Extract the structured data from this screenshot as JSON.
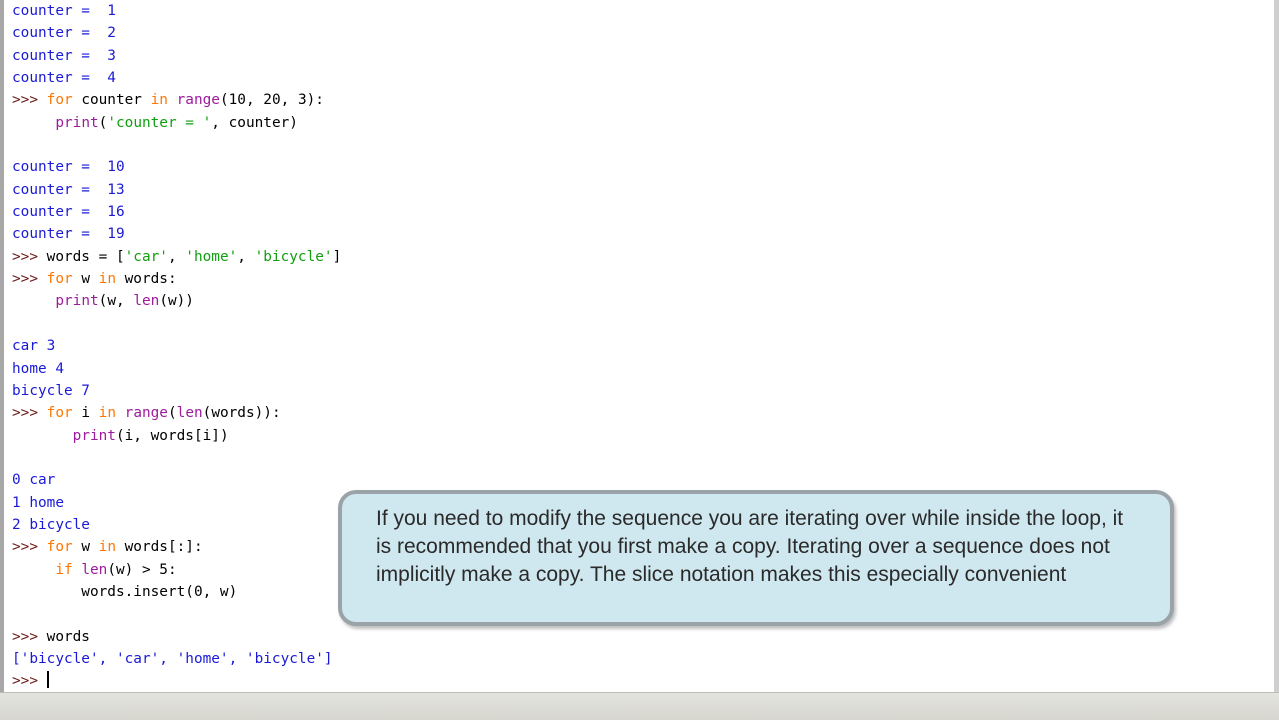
{
  "console": {
    "lines": [
      [
        {
          "t": "counter =  1",
          "c": "out"
        }
      ],
      [
        {
          "t": "counter =  2",
          "c": "out"
        }
      ],
      [
        {
          "t": "counter =  3",
          "c": "out"
        }
      ],
      [
        {
          "t": "counter =  4",
          "c": "out"
        }
      ],
      [
        {
          "t": ">>> ",
          "c": "prompt"
        },
        {
          "t": "for",
          "c": "kw"
        },
        {
          "t": " counter ",
          "c": ""
        },
        {
          "t": "in",
          "c": "kw"
        },
        {
          "t": " ",
          "c": ""
        },
        {
          "t": "range",
          "c": "bi"
        },
        {
          "t": "(10, 20, 3):",
          "c": ""
        }
      ],
      [
        {
          "t": "     ",
          "c": ""
        },
        {
          "t": "print",
          "c": "bi"
        },
        {
          "t": "(",
          "c": ""
        },
        {
          "t": "'counter = '",
          "c": "str"
        },
        {
          "t": ", counter)",
          "c": ""
        }
      ],
      [
        {
          "t": "",
          "c": ""
        }
      ],
      [
        {
          "t": "counter =  10",
          "c": "out"
        }
      ],
      [
        {
          "t": "counter =  13",
          "c": "out"
        }
      ],
      [
        {
          "t": "counter =  16",
          "c": "out"
        }
      ],
      [
        {
          "t": "counter =  19",
          "c": "out"
        }
      ],
      [
        {
          "t": ">>> ",
          "c": "prompt"
        },
        {
          "t": "words = [",
          "c": ""
        },
        {
          "t": "'car'",
          "c": "str"
        },
        {
          "t": ", ",
          "c": ""
        },
        {
          "t": "'home'",
          "c": "str"
        },
        {
          "t": ", ",
          "c": ""
        },
        {
          "t": "'bicycle'",
          "c": "str"
        },
        {
          "t": "]",
          "c": ""
        }
      ],
      [
        {
          "t": ">>> ",
          "c": "prompt"
        },
        {
          "t": "for",
          "c": "kw"
        },
        {
          "t": " w ",
          "c": ""
        },
        {
          "t": "in",
          "c": "kw"
        },
        {
          "t": " words:",
          "c": ""
        }
      ],
      [
        {
          "t": "     ",
          "c": ""
        },
        {
          "t": "print",
          "c": "bi"
        },
        {
          "t": "(w, ",
          "c": ""
        },
        {
          "t": "len",
          "c": "bi"
        },
        {
          "t": "(w))",
          "c": ""
        }
      ],
      [
        {
          "t": "",
          "c": ""
        }
      ],
      [
        {
          "t": "car 3",
          "c": "out"
        }
      ],
      [
        {
          "t": "home 4",
          "c": "out"
        }
      ],
      [
        {
          "t": "bicycle 7",
          "c": "out"
        }
      ],
      [
        {
          "t": ">>> ",
          "c": "prompt"
        },
        {
          "t": "for",
          "c": "kw"
        },
        {
          "t": " i ",
          "c": ""
        },
        {
          "t": "in",
          "c": "kw"
        },
        {
          "t": " ",
          "c": ""
        },
        {
          "t": "range",
          "c": "bi"
        },
        {
          "t": "(",
          "c": ""
        },
        {
          "t": "len",
          "c": "bi"
        },
        {
          "t": "(words)):",
          "c": ""
        }
      ],
      [
        {
          "t": "       ",
          "c": ""
        },
        {
          "t": "print",
          "c": "bi"
        },
        {
          "t": "(i, words[i])",
          "c": ""
        }
      ],
      [
        {
          "t": "",
          "c": ""
        }
      ],
      [
        {
          "t": "0 car",
          "c": "out"
        }
      ],
      [
        {
          "t": "1 home",
          "c": "out"
        }
      ],
      [
        {
          "t": "2 bicycle",
          "c": "out"
        }
      ],
      [
        {
          "t": ">>> ",
          "c": "prompt"
        },
        {
          "t": "for",
          "c": "kw"
        },
        {
          "t": " w ",
          "c": ""
        },
        {
          "t": "in",
          "c": "kw"
        },
        {
          "t": " words[:]:",
          "c": ""
        }
      ],
      [
        {
          "t": "     ",
          "c": ""
        },
        {
          "t": "if",
          "c": "kw"
        },
        {
          "t": " ",
          "c": ""
        },
        {
          "t": "len",
          "c": "bi"
        },
        {
          "t": "(w) > 5:",
          "c": ""
        }
      ],
      [
        {
          "t": "        words.insert(0, w)",
          "c": ""
        }
      ],
      [
        {
          "t": "",
          "c": ""
        }
      ],
      [
        {
          "t": ">>> ",
          "c": "prompt"
        },
        {
          "t": "words",
          "c": ""
        }
      ],
      [
        {
          "t": "['bicycle', 'car', 'home', 'bicycle']",
          "c": "out"
        }
      ]
    ],
    "prompt": ">>> "
  },
  "callout": {
    "text": "If you need to modify the sequence you are iterating over while inside the loop, it is recommended that you first make a copy. Iterating over a sequence does not implicitly make a copy. The slice notation makes this especially convenient"
  },
  "colors": {
    "output": "#1a1ad6",
    "keyword": "#ff7700",
    "builtin": "#9d1b9d",
    "string": "#11a011",
    "callout_bg": "#cfe7ee"
  }
}
